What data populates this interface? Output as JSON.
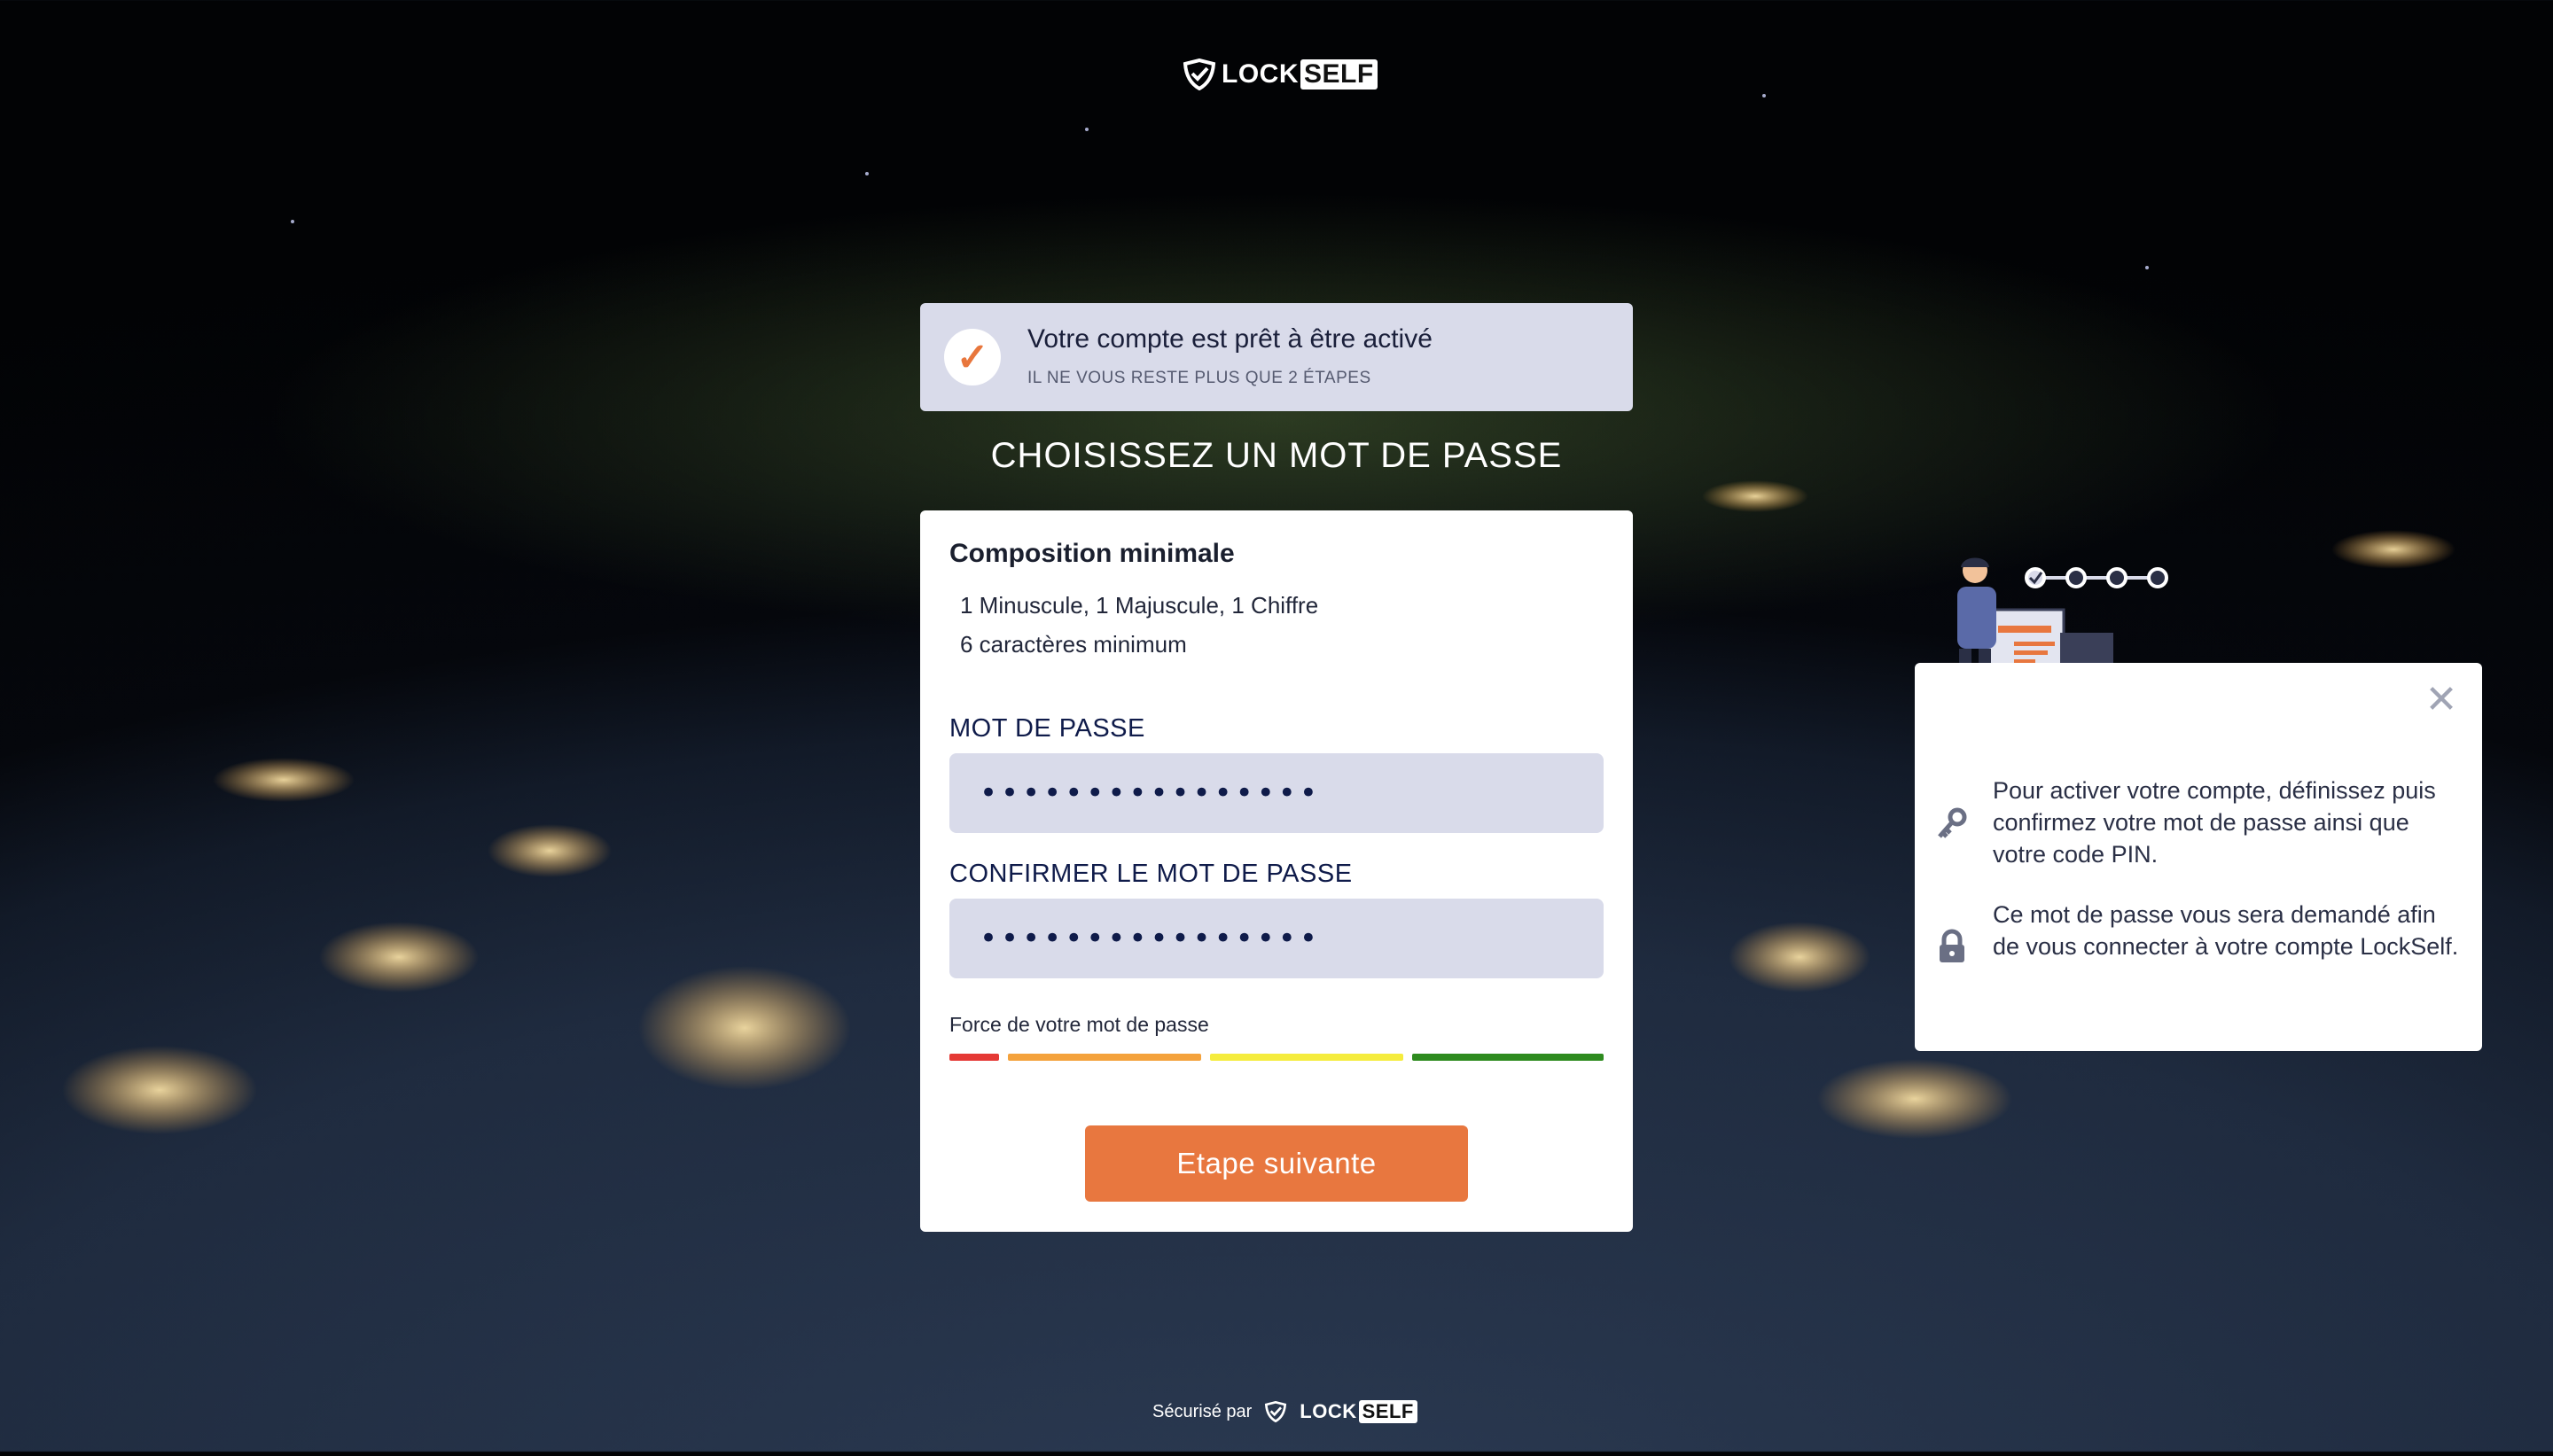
{
  "brand": {
    "lock": "LOCK",
    "self": "SELF"
  },
  "banner": {
    "title": "Votre compte est prêt à être activé",
    "subtitle": "IL NE VOUS RESTE PLUS QUE 2 ÉTAPES"
  },
  "heading": "CHOISISSEZ UN MOT DE PASSE",
  "form": {
    "composition_title": "Composition minimale",
    "rules": [
      "1 Minuscule, 1 Majuscule, 1 Chiffre",
      "6 caractères minimum"
    ],
    "password_label": "MOT DE PASSE",
    "password_value": "••••••••••••••••",
    "confirm_label": "CONFIRMER LE MOT DE PASSE",
    "confirm_value": "••••••••••••••••",
    "strength_label": "Force de votre mot de passe",
    "strength_colors": [
      "#e53935",
      "#f4a23c",
      "#f5ec3d",
      "#2e8b1f"
    ],
    "submit_label": "Etape suivante"
  },
  "help": {
    "close_symbol": "✕",
    "paragraph_1": "Pour activer votre compte, définissez puis confirmez votre mot de passe ainsi que votre code PIN.",
    "paragraph_2": "Ce mot de passe vous sera demandé afin de vous connecter à votre compte LockSelf."
  },
  "footer": {
    "secured_by": "Sécurisé par"
  },
  "colors": {
    "accent": "#e8773f",
    "field_bg": "#d9dbea",
    "label": "#0f1b4a"
  }
}
